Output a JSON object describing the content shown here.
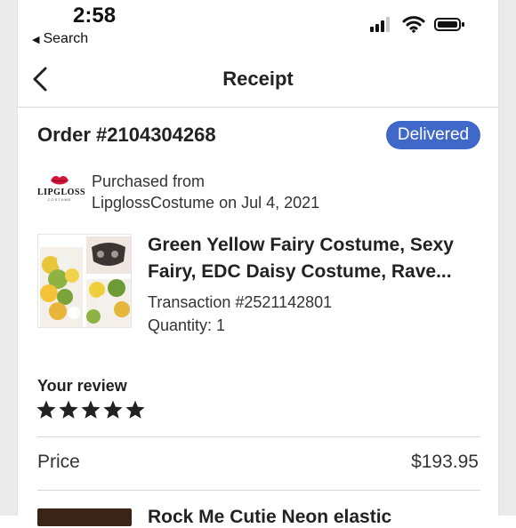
{
  "status_bar": {
    "time": "2:58",
    "back_label": "Search"
  },
  "header": {
    "title": "Receipt"
  },
  "order": {
    "number": "Order #2104304268",
    "status": "Delivered",
    "status_color": "#3f68c9"
  },
  "shop": {
    "logo_text": "LIPGLOSS",
    "logo_subtext": "COSTUME",
    "purchased_from_label": "Purchased from",
    "shop_and_date": "LipglossCostume on Jul 4, 2021"
  },
  "item": {
    "title_line_1": "Green Yellow Fairy Costume, Sexy",
    "title_line_2": "Fairy, EDC Daisy Costume, Rave...",
    "transaction": "Transaction #2521142801",
    "quantity": "Quantity: 1"
  },
  "review": {
    "heading": "Your review",
    "rating": 5,
    "max_rating": 5
  },
  "price": {
    "label": "Price",
    "value": "$193.95"
  },
  "next_item": {
    "title_partial": "Rock Me Cutie Neon elastic"
  },
  "icons": {
    "back": "chevron-left-icon",
    "star": "star-icon",
    "wifi": "wifi-icon",
    "battery": "battery-icon",
    "signal": "cellular-signal-icon"
  }
}
